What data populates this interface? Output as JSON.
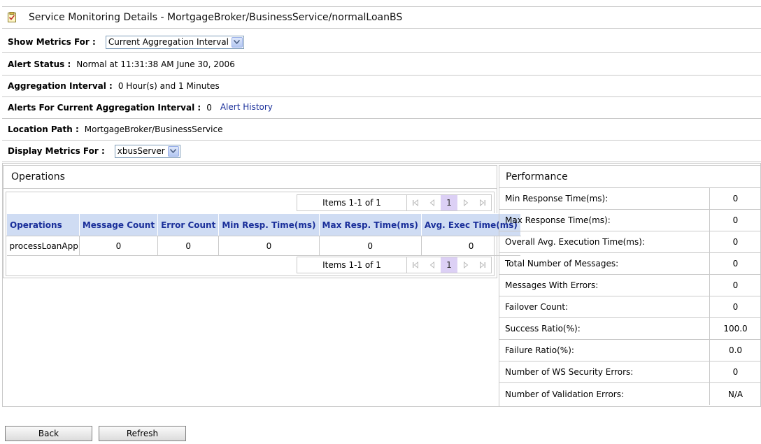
{
  "page_title": "Service Monitoring Details - MortgageBroker/BusinessService/normalLoanBS",
  "show_metrics": {
    "label": "Show Metrics For :",
    "selected": "Current Aggregation Interval"
  },
  "alert_status": {
    "label": "Alert Status :",
    "value": "Normal at 11:31:38 AM June 30, 2006"
  },
  "aggregation_interval": {
    "label": "Aggregation Interval :",
    "value": "0 Hour(s) and 1 Minutes"
  },
  "alerts_current": {
    "label": "Alerts For Current Aggregation Interval :",
    "value": "0",
    "link": "Alert History"
  },
  "location_path": {
    "label": "Location Path :",
    "value": "MortgageBroker/BusinessService"
  },
  "display_metrics": {
    "label": "Display Metrics For :",
    "selected": "xbusServer"
  },
  "operations": {
    "title": "Operations",
    "pager": {
      "text": "Items 1-1 of 1",
      "page": "1"
    },
    "columns": [
      "Operations",
      "Message Count",
      "Error Count",
      "Min Resp. Time(ms)",
      "Max Resp. Time(ms)",
      "Avg. Exec Time(ms)"
    ],
    "rows": [
      [
        "processLoanApp",
        "0",
        "0",
        "0",
        "0",
        "0"
      ]
    ]
  },
  "performance": {
    "title": "Performance",
    "rows": [
      {
        "label": "Min Response Time(ms):",
        "value": "0"
      },
      {
        "label": "Max Response Time(ms):",
        "value": "0"
      },
      {
        "label": "Overall Avg. Execution Time(ms):",
        "value": "0"
      },
      {
        "label": "Total Number of Messages:",
        "value": "0"
      },
      {
        "label": "Messages With Errors:",
        "value": "0"
      },
      {
        "label": "Failover Count:",
        "value": "0"
      },
      {
        "label": "Success Ratio(%):",
        "value": "100.0"
      },
      {
        "label": "Failure Ratio(%):",
        "value": "0.0"
      },
      {
        "label": "Number of WS Security Errors:",
        "value": "0"
      },
      {
        "label": "Number of Validation Errors:",
        "value": "N/A"
      }
    ]
  },
  "buttons": {
    "back": "Back",
    "refresh": "Refresh"
  }
}
